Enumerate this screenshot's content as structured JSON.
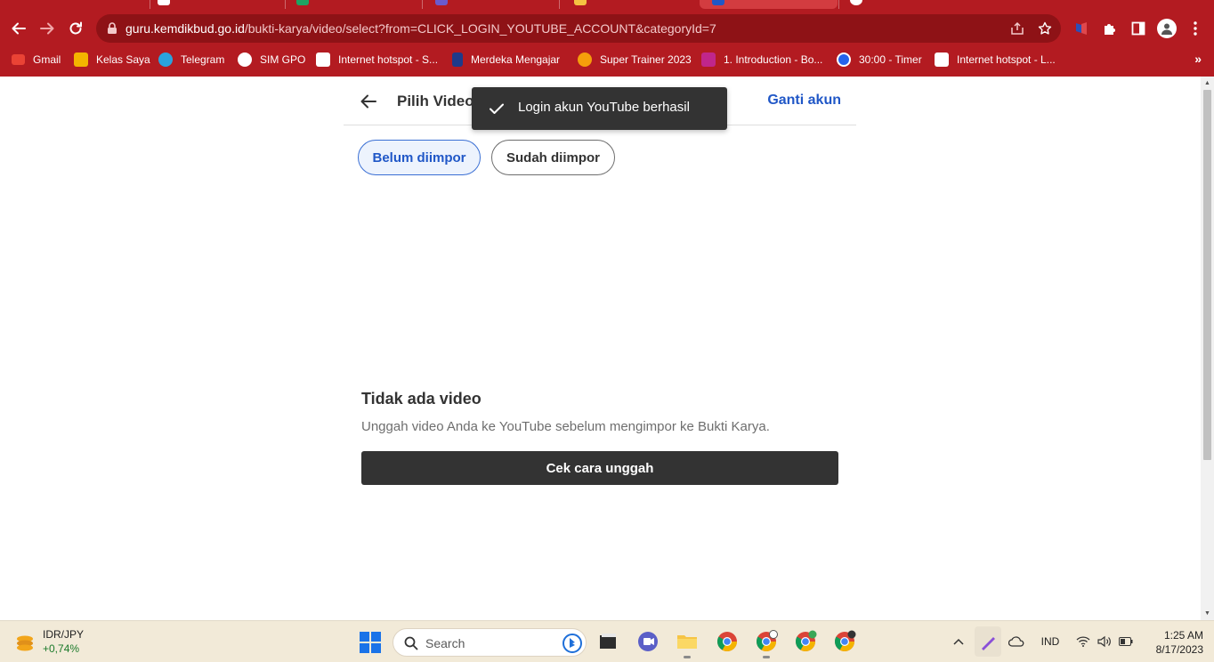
{
  "browser": {
    "url": {
      "host": "guru.kemdikbud.go.id",
      "path": "/bukti-karya/video/select?from=CLICK_LOGIN_YOUTUBE_ACCOUNT&categoryId=7"
    },
    "accent_color": "#b31b21",
    "nav_icons": [
      "back-arrow-icon",
      "forward-arrow-icon",
      "reload-icon"
    ],
    "omnibox_icons": [
      "share-icon",
      "star-icon"
    ],
    "toolbar_icons": [
      "extension-red-icon",
      "puzzle-icon",
      "side-panel-icon",
      "profile-avatar-icon",
      "kebab-menu-icon"
    ],
    "bookmarks": [
      {
        "label": "Gmail",
        "icon": "gmail-icon",
        "color": "#ea4335"
      },
      {
        "label": "Kelas Saya",
        "icon": "classroom-icon",
        "color": "#f4b400"
      },
      {
        "label": "Telegram",
        "icon": "telegram-icon",
        "color": "#2aa3dd"
      },
      {
        "label": "SIM GPO",
        "icon": "globe-icon",
        "color": "#ffffff"
      },
      {
        "label": "Internet hotspot - S...",
        "icon": "hotspot-icon",
        "color": "#ffffff"
      },
      {
        "label": "Merdeka Mengajar",
        "icon": "merdeka-icon",
        "color": "#1e3a8a"
      },
      {
        "label": "Super Trainer 2023",
        "icon": "trainer-icon",
        "color": "#f59e0b"
      },
      {
        "label": "1. Introduction - Bo...",
        "icon": "intro-icon",
        "color": "#c0268b"
      },
      {
        "label": "30:00 - Timer",
        "icon": "timer-icon",
        "color": "#2563eb"
      },
      {
        "label": "Internet hotspot - L...",
        "icon": "hotspot-alt-icon",
        "color": "#ffffff"
      }
    ],
    "more_bookmarks_glyph": "»"
  },
  "page": {
    "title": "Pilih Video",
    "switch_account": "Ganti akun",
    "tabs": [
      {
        "label": "Belum diimpor",
        "selected": true
      },
      {
        "label": "Sudah diimpor",
        "selected": false
      }
    ],
    "toast": {
      "text": "Login akun YouTube berhasil"
    },
    "empty": {
      "title": "Tidak ada video",
      "description": "Unggah video Anda ke YouTube sebelum mengimpor ke Bukti Karya.",
      "cta": "Cek cara unggah"
    }
  },
  "taskbar": {
    "widget": {
      "pair": "IDR/JPY",
      "change": "+0,74%"
    },
    "search_placeholder": "Search",
    "apps": [
      "file-explorer-white-icon",
      "teams-meet-icon",
      "folder-icon",
      "chrome-icon",
      "chrome-profile-icon",
      "chrome-green-icon",
      "chrome-dev-icon"
    ],
    "tray": {
      "language": "IND",
      "time": "1:25 AM",
      "date": "8/17/2023"
    }
  }
}
